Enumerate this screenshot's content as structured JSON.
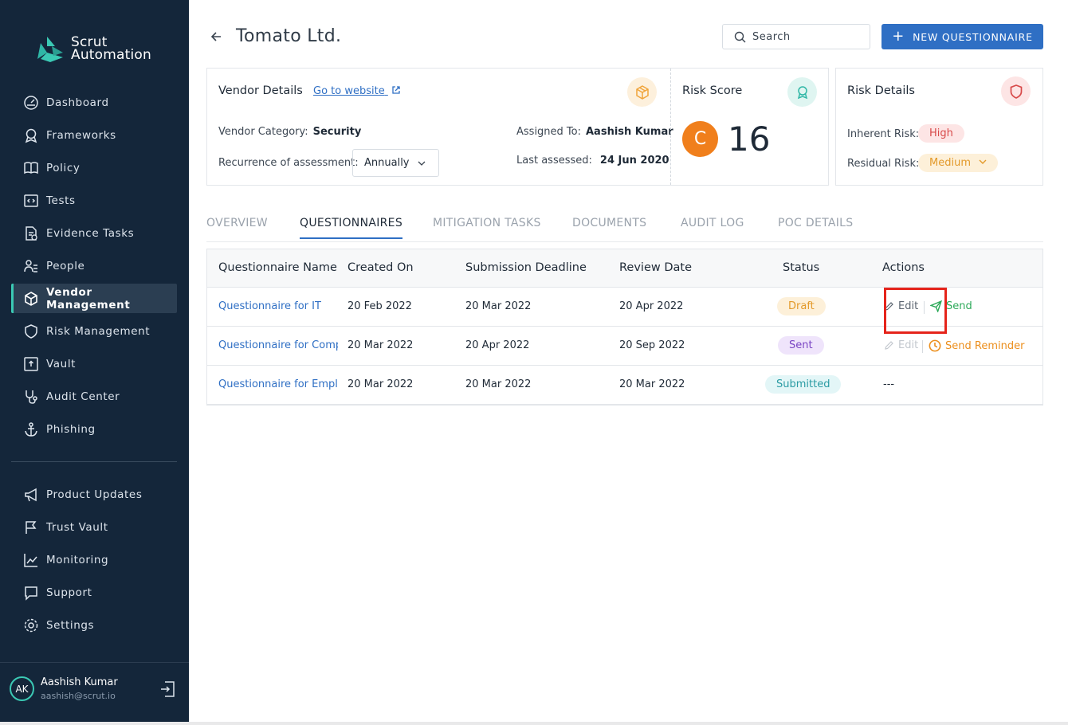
{
  "brand": {
    "name_line1": "Scrut",
    "name_line2": "Automation"
  },
  "sidebar": {
    "items": [
      {
        "label": "Dashboard",
        "icon": "dashboard-icon"
      },
      {
        "label": "Frameworks",
        "icon": "award-icon"
      },
      {
        "label": "Policy",
        "icon": "book-icon"
      },
      {
        "label": "Tests",
        "icon": "code-icon"
      },
      {
        "label": "Evidence Tasks",
        "icon": "document-check-icon"
      },
      {
        "label": "People",
        "icon": "people-icon"
      },
      {
        "label": "Vendor Management",
        "icon": "box-icon",
        "active": true
      },
      {
        "label": "Risk Management",
        "icon": "shield-icon"
      },
      {
        "label": "Vault",
        "icon": "vault-icon"
      },
      {
        "label": "Audit Center",
        "icon": "stethoscope-icon"
      },
      {
        "label": "Phishing",
        "icon": "anchor-icon"
      }
    ],
    "secondary": [
      {
        "label": "Product Updates",
        "icon": "megaphone-icon"
      },
      {
        "label": "Trust Vault",
        "icon": "flag-icon"
      },
      {
        "label": "Monitoring",
        "icon": "chart-line-icon"
      },
      {
        "label": "Support",
        "icon": "chat-icon"
      },
      {
        "label": "Settings",
        "icon": "gear-icon"
      }
    ],
    "user": {
      "initials": "AK",
      "name": "Aashish Kumar",
      "email": "aashish@scrut.io"
    }
  },
  "header": {
    "title": "Tomato Ltd.",
    "search_placeholder": "Search",
    "new_button": "NEW QUESTIONNAIRE"
  },
  "vendor": {
    "heading": "Vendor Details",
    "website_link": "Go to website",
    "category_label": "Vendor Category:",
    "category_value": "Security",
    "recurrence_label": "Recurrence of assessment:",
    "recurrence_value": "Annually",
    "assigned_label": "Assigned To:",
    "assigned_value": "Aashish Kumar",
    "last_label": "Last assessed:",
    "last_value": "24 Jun 2020",
    "risk_score_heading": "Risk Score",
    "grade": "C",
    "score": "16"
  },
  "risk": {
    "heading": "Risk Details",
    "inherent_label": "Inherent Risk:",
    "inherent_value": "High",
    "residual_label": "Residual Risk:",
    "residual_value": "Medium"
  },
  "tabs": [
    "OVERVIEW",
    "QUESTIONNAIRES",
    "MITIGATION TASKS",
    "DOCUMENTS",
    "AUDIT LOG",
    "POC DETAILS"
  ],
  "table": {
    "headers": [
      "Questionnaire Name",
      "Created On",
      "Submission Deadline",
      "Review Date",
      "Status",
      "Actions"
    ],
    "rows": [
      {
        "name": "Questionnaire for IT",
        "created": "20 Feb 2022",
        "deadline": "20 Mar 2022",
        "review": "20 Apr 2022",
        "status": "Draft",
        "edit": "Edit",
        "action": "Send"
      },
      {
        "name": "Questionnaire for Compl",
        "created": "20 Mar 2022",
        "deadline": "20 Apr 2022",
        "review": "20 Sep 2022",
        "status": "Sent",
        "edit": "Edit",
        "action": "Send Reminder"
      },
      {
        "name": "Questionnaire for Emplo",
        "created": "20 Mar 2022",
        "deadline": "20 Mar 2022",
        "review": "20 Mar 2022",
        "status": "Submitted",
        "action": "---"
      }
    ]
  },
  "colors": {
    "sidebar": "#14263a",
    "accent": "#2f6fc4",
    "teal": "#3bc9b4",
    "grade": "#f07f1c",
    "highlight": "#e5241b"
  }
}
